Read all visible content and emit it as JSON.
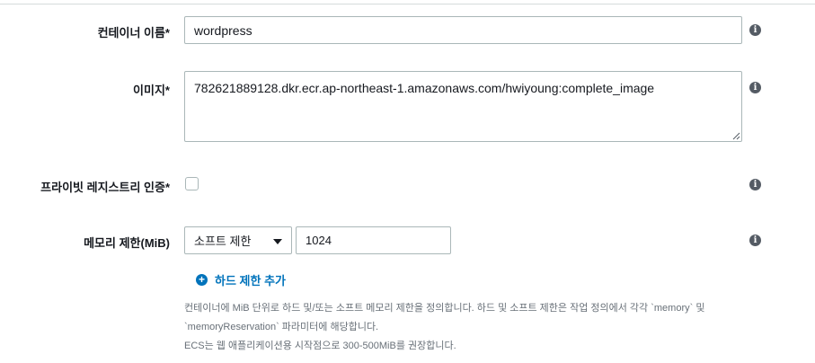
{
  "fields": {
    "container_name": {
      "label": "컨테이너 이름*",
      "value": "wordpress"
    },
    "image": {
      "label": "이미지*",
      "value": "782621889128.dkr.ecr.ap-northeast-1.amazonaws.com/hwiyoung:complete_image"
    },
    "private_registry": {
      "label": "프라이빗 레지스트리 인증*",
      "checked": false
    },
    "memory_limit": {
      "label": "메모리 제한(MiB)",
      "select_value": "소프트 제한",
      "value": "1024",
      "add_hard_limit": "하드 제한 추가",
      "help_lines": [
        "컨테이너에 MiB 단위로 하드 및/또는 소프트 메모리 제한을 정의합니다. 하드 및 소프트 제한은 작업 정의에서 각각 `memory` 및",
        "`memoryReservation` 파라미터에 해당합니다.",
        "ECS는 웹 애플리케이션용 시작점으로 300-500MiB를 권장합니다."
      ]
    }
  },
  "icons": {
    "info": "info-icon",
    "add": "plus-circle-icon",
    "dropdown": "caret-down-icon"
  },
  "colors": {
    "link": "#0073bb",
    "border": "#aab7b8",
    "info_icon": "#545b64",
    "help_text": "#687078"
  }
}
